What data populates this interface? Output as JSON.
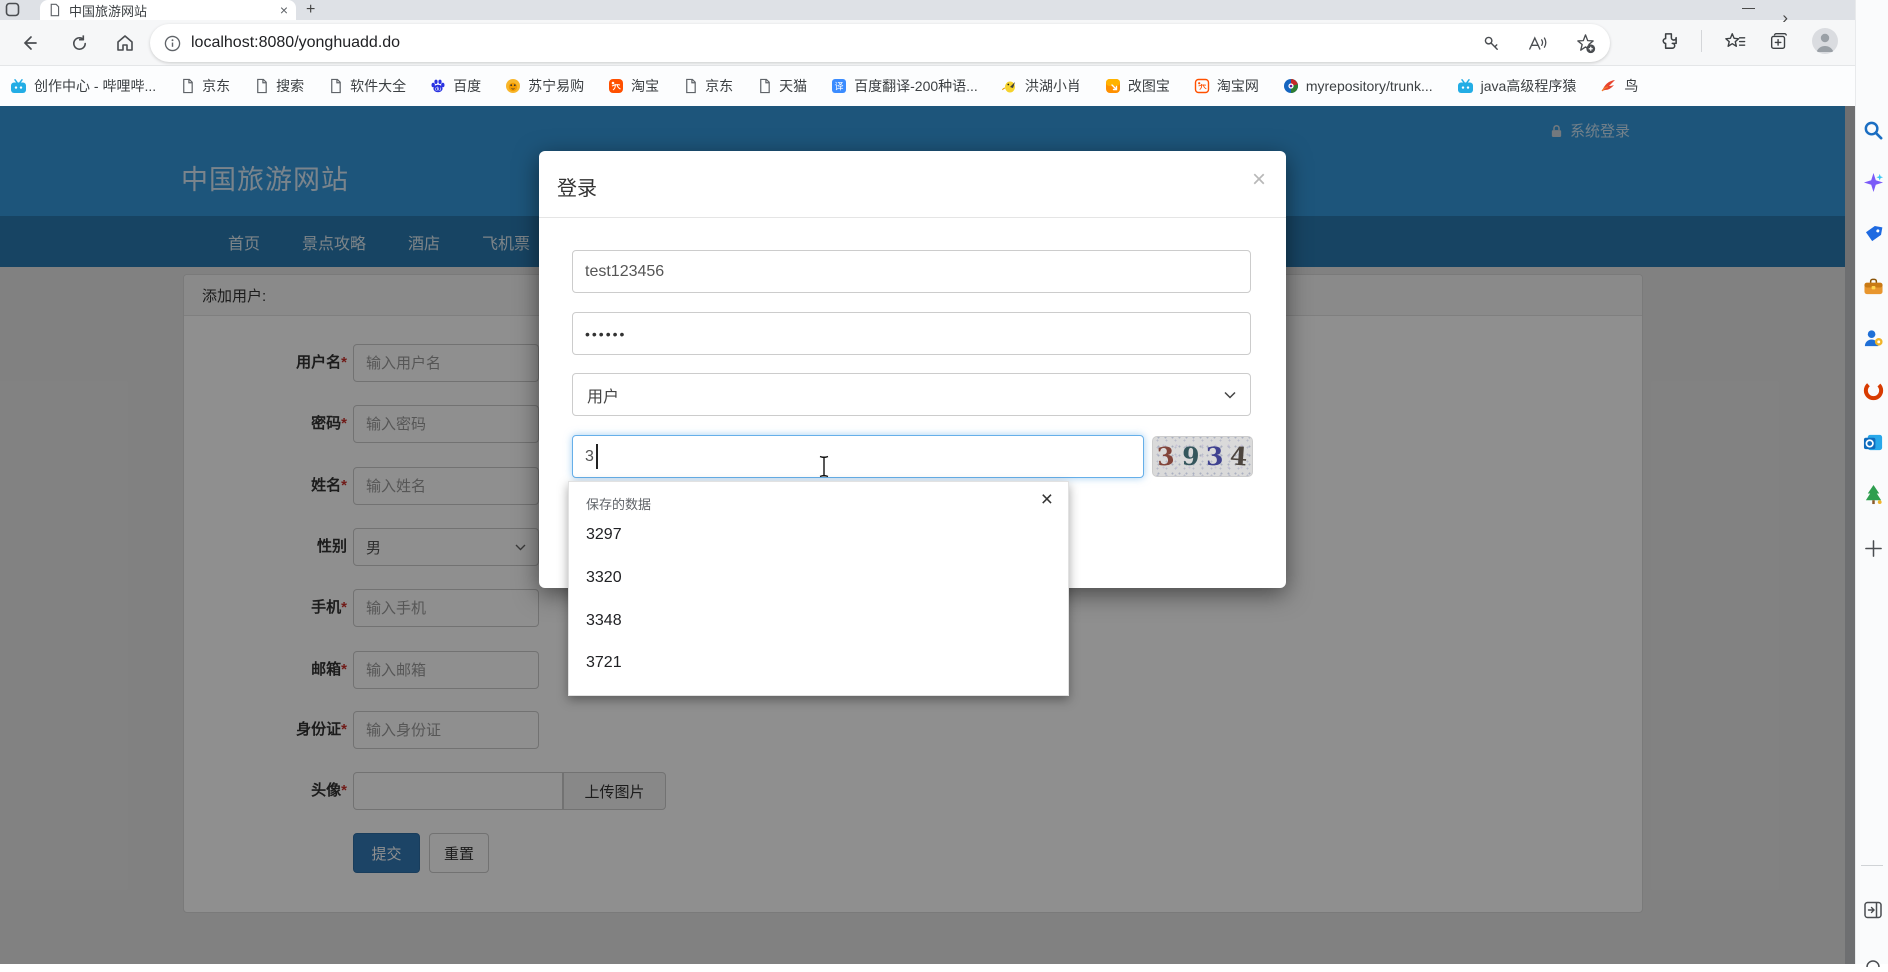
{
  "icons": {
    "close": "×",
    "new_tab": "+",
    "minimize": "—",
    "more": "⋯",
    "bookmarks_overflow": "›"
  },
  "colors": {
    "header_blue": "#3498db",
    "nav_blue": "#2a7ab0",
    "primary": "#337ab7"
  },
  "browser": {
    "tab_title": "中国旅游网站",
    "url": "localhost:8080/yonghuadd.do",
    "bookmarks": [
      {
        "label": "创作中心 - 哔哩哔...",
        "icon": "bilibili-icon"
      },
      {
        "label": "京东",
        "icon": "page-icon"
      },
      {
        "label": "搜索",
        "icon": "page-icon"
      },
      {
        "label": "软件大全",
        "icon": "page-icon"
      },
      {
        "label": "百度",
        "icon": "baidu-paw-icon"
      },
      {
        "label": "苏宁易购",
        "icon": "suning-lion-icon"
      },
      {
        "label": "淘宝",
        "icon": "taobao-icon"
      },
      {
        "label": "京东",
        "icon": "page-icon"
      },
      {
        "label": "天猫",
        "icon": "page-icon"
      },
      {
        "label": "百度翻译-200种语...",
        "icon": "baidu-translate-icon"
      },
      {
        "label": "洪湖小肖",
        "icon": "yellow-bird-icon"
      },
      {
        "label": "改图宝",
        "icon": "gaitubao-icon"
      },
      {
        "label": "淘宝网",
        "icon": "taobao-outline-icon"
      },
      {
        "label": "myrepository/trunk...",
        "icon": "repo-sphere-icon"
      },
      {
        "label": "java高级程序猿",
        "icon": "bilibili-icon"
      },
      {
        "label": "鸟",
        "icon": "red-bird-icon"
      }
    ]
  },
  "site": {
    "brand": "中国旅游网站",
    "login_link": "系统登录",
    "nav": [
      {
        "label": "首页"
      },
      {
        "label": "景点攻略"
      },
      {
        "label": "酒店"
      },
      {
        "label": "飞机票"
      }
    ],
    "panel_heading": "添加用户:",
    "form": {
      "fields": [
        {
          "label": "用户名",
          "star": "*",
          "placeholder": "输入用户名"
        },
        {
          "label": "密码",
          "star": "*",
          "placeholder": "输入密码"
        },
        {
          "label": "姓名",
          "star": "*",
          "placeholder": "输入姓名"
        },
        {
          "label": "性别",
          "star": "",
          "value": "男"
        },
        {
          "label": "手机",
          "star": "*",
          "placeholder": "输入手机"
        },
        {
          "label": "邮箱",
          "star": "*",
          "placeholder": "输入邮箱"
        },
        {
          "label": "身份证",
          "star": "*",
          "placeholder": "输入身份证"
        },
        {
          "label": "头像",
          "star": "*",
          "upload_button": "上传图片"
        }
      ],
      "submit": "提交",
      "reset": "重置"
    }
  },
  "modal": {
    "title": "登录",
    "username": "test123456",
    "password": "••••••",
    "role": "用户",
    "captcha_input": "3",
    "captcha_digits": [
      {
        "d": "3",
        "c": "#82443a"
      },
      {
        "d": "9",
        "c": "#34565c"
      },
      {
        "d": "3",
        "c": "#3f4190"
      },
      {
        "d": "4",
        "c": "#4d453e"
      }
    ]
  },
  "autocomplete": {
    "header": "保存的数据",
    "items": [
      {
        "v": "3297"
      },
      {
        "v": "3320"
      },
      {
        "v": "3348"
      },
      {
        "v": "3721"
      }
    ]
  }
}
